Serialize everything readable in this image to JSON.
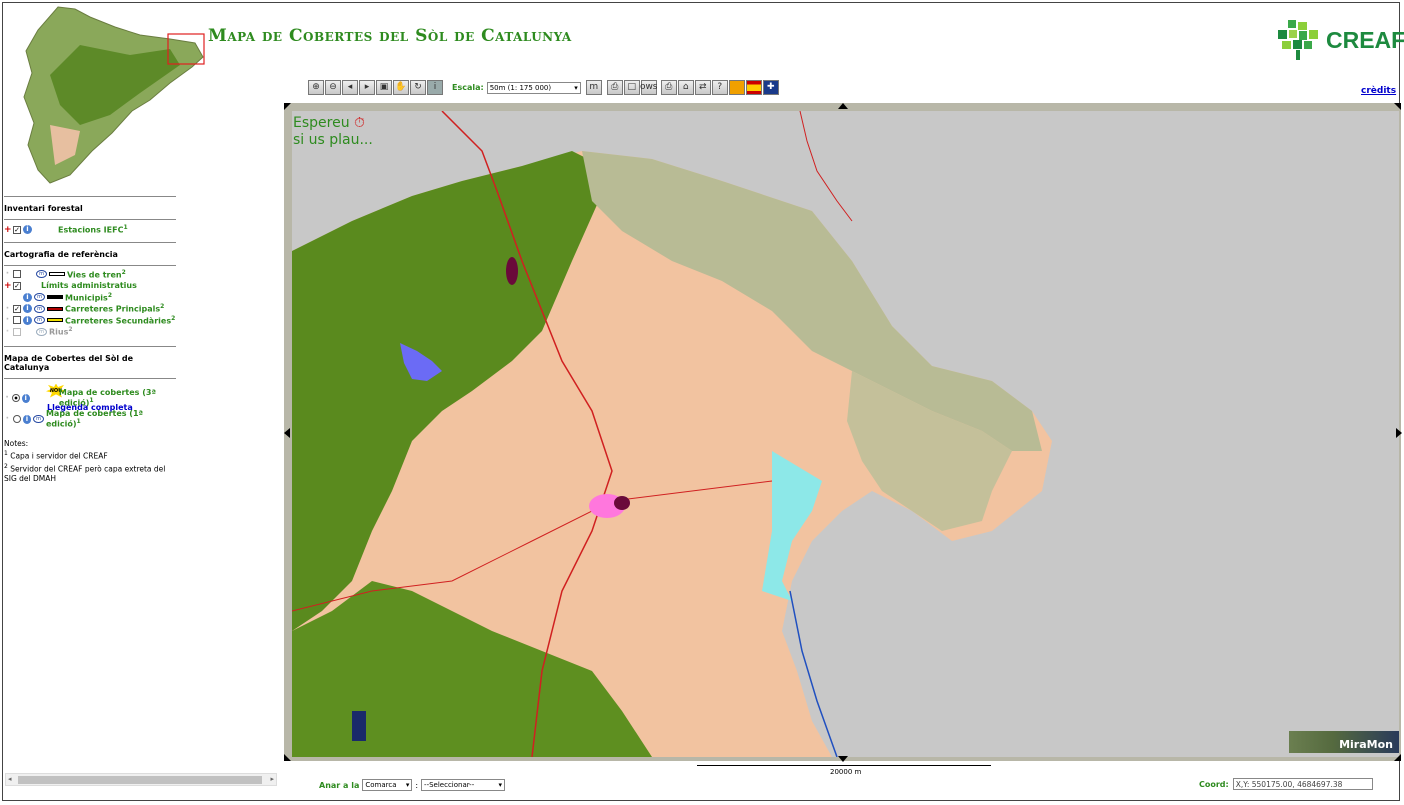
{
  "app": {
    "title": "Mapa de Cobertes del Sòl de Catalunya",
    "logo_text": "CREAF",
    "credits_link": "crèdits"
  },
  "toolbar": {
    "scale_label": "Escala:",
    "scale_value": "50m (1: 175 000)",
    "buttons": [
      "zoom-in-icon",
      "zoom-out-icon",
      "zoom-prev-icon",
      "zoom-next-icon",
      "zoom-extent-icon",
      "pan-hand-icon",
      "refresh-icon",
      "info-icon",
      "miramon-icon",
      "print-icon",
      "window-icon",
      "ows-icon",
      "printer-icon",
      "home-icon",
      "connect-icon",
      "help-icon",
      "layers-icon",
      "spain-flag-icon",
      "uk-flag-icon"
    ]
  },
  "sidebar": {
    "sections": [
      {
        "title": "Inventari forestal",
        "layers": [
          {
            "name": "Estacions IEFC",
            "sup": "1",
            "checked": true,
            "expand": "+"
          }
        ]
      },
      {
        "title": "Cartografia de referència",
        "layers": [
          {
            "name": "Vies de tren",
            "sup": "2",
            "checked": false,
            "symbol": "#ffffff"
          },
          {
            "name": "Límits administratius",
            "sup": "",
            "checked": true,
            "expand": "+"
          },
          {
            "name": "Municipis",
            "sup": "2",
            "checked": false,
            "symbol": "#000000"
          },
          {
            "name": "Carreteres Principals",
            "sup": "2",
            "checked": true,
            "symbol": "#b00000"
          },
          {
            "name": "Carreteres Secundàries",
            "sup": "2",
            "checked": false,
            "symbol": "#f0e000"
          },
          {
            "name": "Rius",
            "sup": "2",
            "checked": false,
            "disabled": true
          }
        ]
      },
      {
        "title": "Mapa de Cobertes del Sòl de Catalunya",
        "layers": [
          {
            "name": "Mapa de cobertes (3ª edició)",
            "sup": "1",
            "selected": true,
            "badge": "NOU",
            "sublink": "Llegenda completa"
          },
          {
            "name": "Mapa de cobertes (1ª edició)",
            "sup": "1",
            "selected": false
          }
        ]
      }
    ],
    "notes_title": "Notes:",
    "notes": [
      {
        "sup": "1",
        "text": "Capa i servidor del CREAF"
      },
      {
        "sup": "2",
        "text": "Servidor del CREAF però capa extreta del SIG del DMAH"
      }
    ]
  },
  "map": {
    "wait_line1": "Espereu",
    "wait_line2": "si us plau...",
    "scalebar_label": "20000 m",
    "logo": "MiraMon",
    "colors": {
      "forest": "#5a8a1e",
      "agriculture": "#f2c3a0",
      "shrub": "#b8bb95",
      "sea": "#c8c8c8",
      "urban": "#ff77dd"
    }
  },
  "footer": {
    "anar_label": "Anar a la",
    "anar_select": "Comarca",
    "anar_select2": "--Seleccionar--",
    "coord_label": "Coord:",
    "coord_value": "X,Y: 550175.00, 4684697.38"
  }
}
